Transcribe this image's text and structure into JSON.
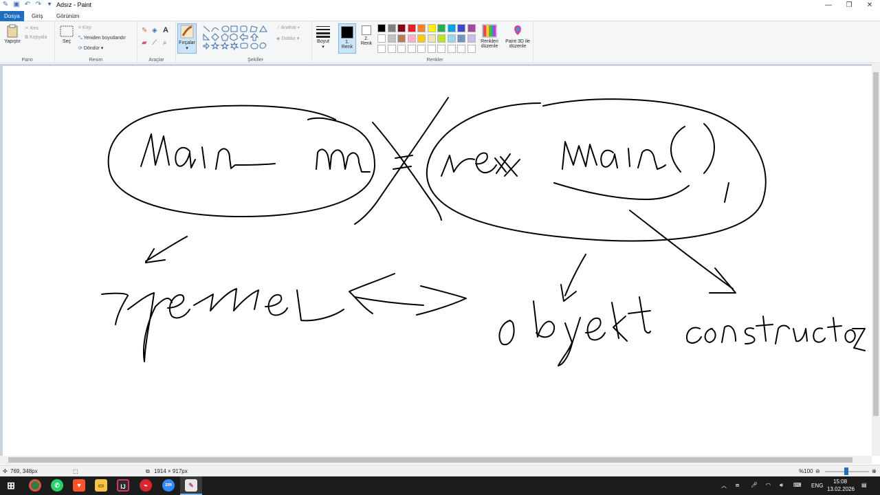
{
  "window": {
    "title": "Adsız - Paint"
  },
  "menu": {
    "file": "Dosya",
    "home": "Giriş",
    "view": "Görünüm"
  },
  "ribbon": {
    "clipboard": {
      "paste": "Yapıştır",
      "cut": "Kes",
      "copy": "Kopyala",
      "label": "Pano"
    },
    "image": {
      "select": "Seç",
      "crop": "Kırp",
      "resize": "Yeniden boyutlandır",
      "rotate": "Döndür",
      "label": "Resim"
    },
    "tools": {
      "label": "Araçlar"
    },
    "brushes": {
      "label": "Fırçalar"
    },
    "shapes": {
      "outline": "Anahat",
      "fill": "Doldur",
      "label": "Şekiller"
    },
    "size": {
      "label": "Boyut"
    },
    "colors": {
      "color1": "1. Renk",
      "color2": "2. Renk",
      "edit": "Renkleri düzenle",
      "paint3d": "Paint 3D ile düzenle",
      "label": "Renkler",
      "palette_row1": [
        "#000000",
        "#7f7f7f",
        "#880015",
        "#ed1c24",
        "#ff7f27",
        "#fff200",
        "#22b14c",
        "#00a2e8",
        "#3f48cc",
        "#a349a4"
      ],
      "palette_row2": [
        "#ffffff",
        "#c3c3c3",
        "#b97a57",
        "#ffaec9",
        "#ffc90e",
        "#efe4b0",
        "#b5e61d",
        "#99d9ea",
        "#7092be",
        "#c8bfe7"
      ]
    }
  },
  "status": {
    "cursor": "769, 348px",
    "size": "1914 × 917px",
    "zoom": "%100"
  },
  "tray": {
    "lang": "ENG",
    "time": "15:08",
    "date": "13.02.2026"
  },
  "taskbar_apps": [
    "windows-icon",
    "chrome-icon",
    "whatsapp-icon",
    "brave-icon",
    "explorer-icon",
    "intellij-icon",
    "pdf-icon",
    "zoom-icon",
    "paint-icon"
  ]
}
